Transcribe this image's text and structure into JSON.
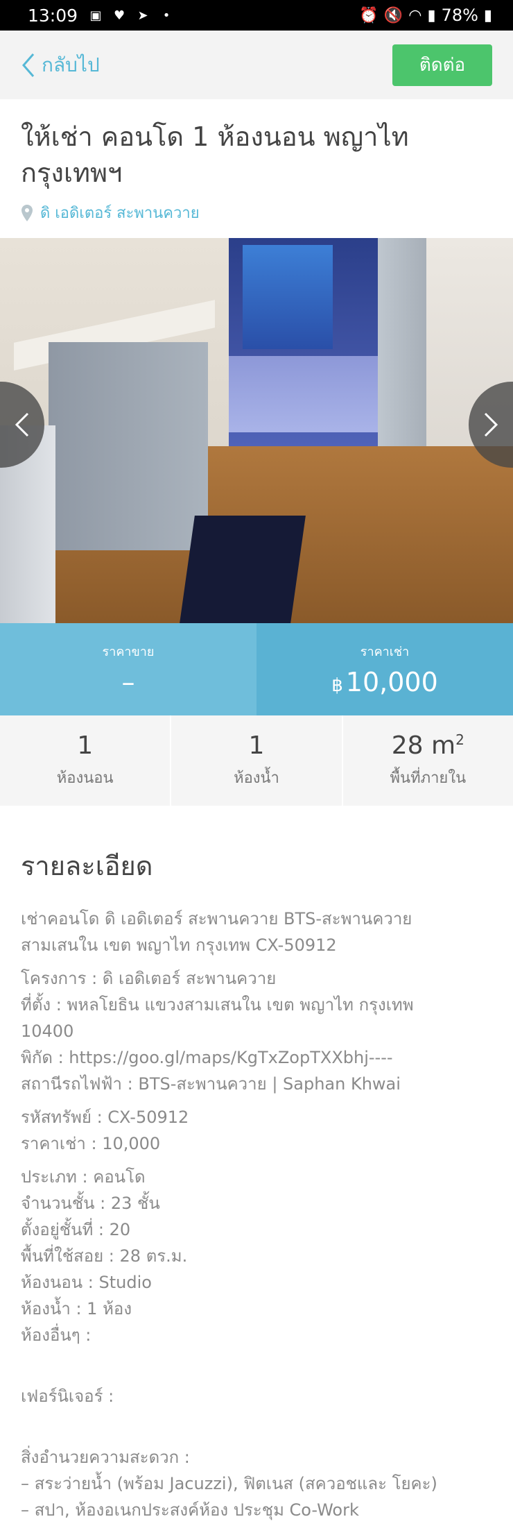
{
  "status_bar": {
    "time": "13:09",
    "battery": "78%"
  },
  "header": {
    "back_label": "กลับไป",
    "contact_label": "ติดต่อ"
  },
  "listing": {
    "title": "ให้เช่า คอนโด 1 ห้องนอน พญาไท กรุงเทพฯ",
    "location": "ดิ เอดิเตอร์ สะพานควาย"
  },
  "price": {
    "sale_label": "ราคาขาย",
    "sale_value": "–",
    "rent_label": "ราคาเช่า",
    "currency_symbol": "฿",
    "rent_value": "10,000"
  },
  "specs": {
    "bedrooms": "1",
    "bedrooms_label": "ห้องนอน",
    "bathrooms": "1",
    "bathrooms_label": "ห้องน้ำ",
    "area": "28 m",
    "area_unit_sup": "2",
    "area_label": "พื้นที่ภายใน"
  },
  "details": {
    "heading": "รายละเอียด",
    "intro": [
      "เช่าคอนโด ดิ เอดิเตอร์ สะพานควาย BTS-สะพานควาย",
      "สามเสนใน เขต พญาไท กรุงเทพ CX-50912"
    ],
    "project_lines": [
      "โครงการ : ดิ เอดิเตอร์ สะพานควาย",
      "ที่ตั้ง : พหลโยธิน แขวงสามเสนใน เขต พญาไท กรุงเทพ",
      "10400",
      "พิกัด : https://goo.gl/maps/KgTxZopTXXbhj----",
      "สถานีรถไฟฟ้า : BTS-สะพานควาย | Saphan Khwai"
    ],
    "code_lines": [
      "รหัสทรัพย์ : CX-50912",
      "ราคาเช่า : 10,000"
    ],
    "property_lines": [
      "ประเภท : คอนโด",
      "จำนวนชั้น : 23 ชั้น",
      "ตั้งอยู่ชั้นที่ : 20",
      "พื้นที่ใช้สอย : 28 ตร.ม.",
      "ห้องนอน : Studio",
      "ห้องน้ำ : 1 ห้อง",
      "ห้องอื่นๆ :"
    ],
    "furniture_label": "เฟอร์นิเจอร์ :",
    "facilities_label": "สิ่งอำนวยความสะดวก :",
    "facilities_lines": [
      "– สระว่ายน้ำ (พร้อม Jacuzzi), ฟิตเนส (สควอชและ โยคะ)",
      "– สปา, ห้องอเนกประสงค์ห้อง ประชุม Co-Work"
    ]
  }
}
